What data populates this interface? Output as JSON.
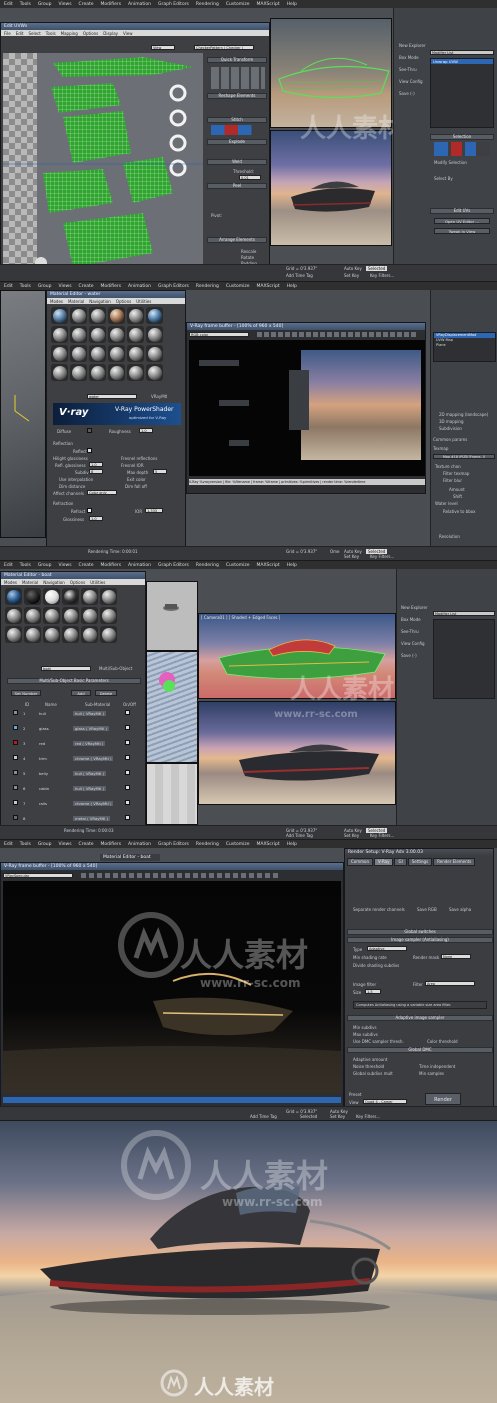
{
  "panel1": {
    "menu": [
      "Edit",
      "Tools",
      "Group",
      "Views",
      "Create",
      "Modifiers",
      "Animation",
      "Graph Editors",
      "Rendering",
      "Customize",
      "MAXScript",
      "Help"
    ],
    "unwrap_title": "Edit UVWs",
    "unwrap_menu": [
      "File",
      "Edit",
      "Select",
      "Tools",
      "Mapping",
      "Options",
      "Display",
      "View"
    ],
    "checker_dropdown": "CheckerPattern ( Checker )",
    "view_dropdown": "View",
    "rollouts": [
      "Quick Transform",
      "Reshape Elements",
      "Stitch",
      "Explode",
      "Weld",
      "Peel",
      "Arrange Elements"
    ],
    "threshold_label": "Threshold:",
    "threshold_value": "0.01",
    "pivot_label": "Pivot:",
    "explode_opts": [
      "Rescale",
      "Rotate",
      "Padding"
    ],
    "cmd_items": [
      "Box Mode",
      "See-Thru",
      "New Explorer",
      "View Config",
      "Save (-)"
    ],
    "modifier_list": "Modifier List",
    "modifier_stack": [
      "Unwrap UVW"
    ],
    "selection_title": "Selection",
    "modify_selection": "Modify Selection",
    "select_by": "Select By",
    "edit_uvs": "Edit UVs",
    "open_uv_editor": "Open UV Editor ...",
    "tweak_in_view": "Tweak In View",
    "status": [
      "Grid = 0'3.937\"",
      "Auto Key",
      "Selected",
      "Set Key",
      "Key Filters...",
      "Add Time Tag"
    ]
  },
  "panel2": {
    "menu": [
      "Edit",
      "Tools",
      "Group",
      "Views",
      "Create",
      "Modifiers",
      "Animation",
      "Graph Editors",
      "Rendering",
      "Customize",
      "MAXScript",
      "Help"
    ],
    "mat_title": "Material Editor - water",
    "mat_menu": [
      "Modes",
      "Material",
      "Navigation",
      "Options",
      "Utilities"
    ],
    "vray_logo": "V·ray",
    "vray_shader": "V-Ray PowerShader",
    "vray_sub": "optimized for V-Ray",
    "mat_name": "water",
    "mat_type": "VRayMtl",
    "basic_params": "Basic parameters",
    "diffuse": "Diffuse",
    "roughness": "Roughness",
    "reflection": "Reflection",
    "reflect": "Reflect",
    "hilight": "Hilight glossiness",
    "refl_gloss": "Refl. glossiness",
    "subdivs": "Subdivs",
    "use_interp": "Use interpolation",
    "dim_distance": "Dim distance",
    "affect_channels": "Affect channels",
    "color_only": "Color only",
    "fresnel": "Fresnel reflections",
    "fresnel_ior": "Fresnel IOR",
    "max_depth": "Max depth",
    "exit_color": "Exit color",
    "dim_falloff": "Dim fall off",
    "refraction": "Refraction",
    "refract": "Refract",
    "glossiness": "Glossiness",
    "ior": "IOR",
    "val_1": "1.0",
    "val_8": "8",
    "val_5": "5",
    "val_06": "0.6",
    "val_1333": "1.333",
    "fb_title": "V-Ray frame buffer - [100% of 960 x 540]",
    "fb_channel": "RGB color",
    "fb_stamp": "V-Ray %vrayversion | file: %filename | frame: %frame | primitives: %primitives | render time: %rendertime",
    "modifier_stack": [
      "VRayDisplacementMod",
      "UVW Map",
      "Plane"
    ],
    "mapping_opts": [
      "2D mapping (landscape)",
      "3D mapping",
      "Subdivision"
    ],
    "common_params": "Common params",
    "texmap": "Texmap",
    "map_label": "Map #18 (PIZB [Frame..])",
    "texture_chan": "Texture chan",
    "filter_texmap": "Filter texmap",
    "filter_blur": "Filter blur",
    "amount": "Amount",
    "shift": "Shift",
    "water_level": "Water level",
    "relative_bbox": "Relative to bbox",
    "resolution": "Resolution",
    "render_time": "Rendering Time: 0:00:01",
    "status": [
      "Grid = 0'3.937\"",
      "Auto Key",
      "Selected",
      "Set Key",
      "Key Filters...",
      "Add Time Tag",
      "Ome"
    ]
  },
  "panel3": {
    "menu": [
      "Edit",
      "Tools",
      "Group",
      "Views",
      "Create",
      "Modifiers",
      "Animation",
      "Graph Editors",
      "Rendering",
      "Customize",
      "MAXScript",
      "Help"
    ],
    "mat_title": "Material Editor - boat",
    "mat_menu": [
      "Modes",
      "Material",
      "Navigation",
      "Options",
      "Utilities"
    ],
    "mat_name": "boat",
    "mat_type": "Multi/Sub-Object",
    "multi_title": "Multi/Sub-Object Basic Parameters",
    "set_number": "Set Number",
    "add": "Add",
    "delete": "Delete",
    "col_id": "ID",
    "col_name": "Name",
    "col_sub": "Sub-Material",
    "col_onoff": "On/Off",
    "rows": [
      {
        "id": "1",
        "name": "hull",
        "sub": "hull ( VRayMtl )",
        "color": "#8a8f94"
      },
      {
        "id": "2",
        "name": "glass",
        "sub": "glass ( VRayMtl )",
        "color": "#6fa8d8"
      },
      {
        "id": "3",
        "name": "red",
        "sub": "red ( VRayMtl )",
        "color": "#b41e1e"
      },
      {
        "id": "4",
        "name": "trim",
        "sub": "chrome ( VRayMtl )",
        "color": "#c7c7c7"
      },
      {
        "id": "5",
        "name": "belly",
        "sub": "hull ( VRayMtl )",
        "color": "#8a8f94"
      },
      {
        "id": "6",
        "name": "cabin",
        "sub": "hull ( VRayMtl )",
        "color": "#8a8f94"
      },
      {
        "id": "7",
        "name": "rails",
        "sub": "chrome ( VRayMtl )",
        "color": "#c7c7c7"
      },
      {
        "id": "8",
        "name": "",
        "sub": "metal ( VRayMtl )",
        "color": "#6a6a6a"
      }
    ],
    "vp_label": "[ Camera01 ] [ Shaded + Edged Faces ]",
    "cmd_items": [
      "New Explorer",
      "Box Mode",
      "See-Thru",
      "View Config",
      "Save (-)"
    ],
    "modifier_list": "Modifier List",
    "render_time": "Rendering Time: 0:00:03",
    "status": [
      "Grid = 0'3.937\"",
      "Auto Key",
      "Selected",
      "Set Key",
      "Key Filters...",
      "Add Time Tag"
    ]
  },
  "panel4": {
    "menu": [
      "Edit",
      "Tools",
      "Group",
      "Views",
      "Create",
      "Modifiers",
      "Animation",
      "Graph Editors",
      "Rendering",
      "Customize",
      "MAXScript",
      "Help"
    ],
    "mat_title": "Material Editor - boat",
    "fb_title": "V-Ray frame buffer - [100% of 960 x 540]",
    "fb_channel": "VRaySpecular",
    "rs_title": "Render Setup: V-Ray Adv 3.00.03",
    "rs_tabs": [
      "Common",
      "V-Ray",
      "GI",
      "Settings",
      "Render Elements"
    ],
    "separate_channels": "Separate render channels",
    "save_rgb": "Save RGB",
    "save_alpha": "Save alpha",
    "global_switches": "Global switches",
    "image_sampler": "Image sampler (Antialiasing)",
    "type_label": "Type",
    "type_value": "Adaptive",
    "min_shading": "Min shading rate",
    "render_mask": "Render mask",
    "none": "None",
    "divide_shading": "Divide shading subdivs",
    "image_filter": "Image filter",
    "filter_label": "Filter",
    "filter_value": "Area",
    "size_label": "Size",
    "size_value": "1.5",
    "filter_desc": "Computes Antialiasing using a variable size area filter.",
    "adaptive_sampler": "Adaptive image sampler",
    "min_subdivs": "Min subdivs",
    "max_subdivs": "Max subdivs",
    "use_dmc": "Use DMC sampler thresh.",
    "color_thresh": "Color threshold",
    "global_dmc": "Global DMC",
    "adaptive_amount": "Adaptive amount",
    "noise_threshold": "Noise threshold",
    "time_independent": "Time independent",
    "global_subdivs": "Global subdivs mult",
    "min_samples": "Min samples",
    "preset": "Preset",
    "view": "View",
    "view_value": "Quad 4 - Camer",
    "render": "Render",
    "status": [
      "Grid = 0'3.937\"",
      "Auto Key",
      "Selected",
      "Set Key",
      "Key Filters...",
      "Add Time Tag"
    ]
  },
  "watermarks": {
    "cn": "人人素材",
    "url": "www.rr-sc.com"
  },
  "colors": {
    "titlebar": "#4a5f7c",
    "uv_green": "#44c444",
    "accent_blue": "#3b6ea5",
    "sunset_orange": "#e0a070"
  }
}
